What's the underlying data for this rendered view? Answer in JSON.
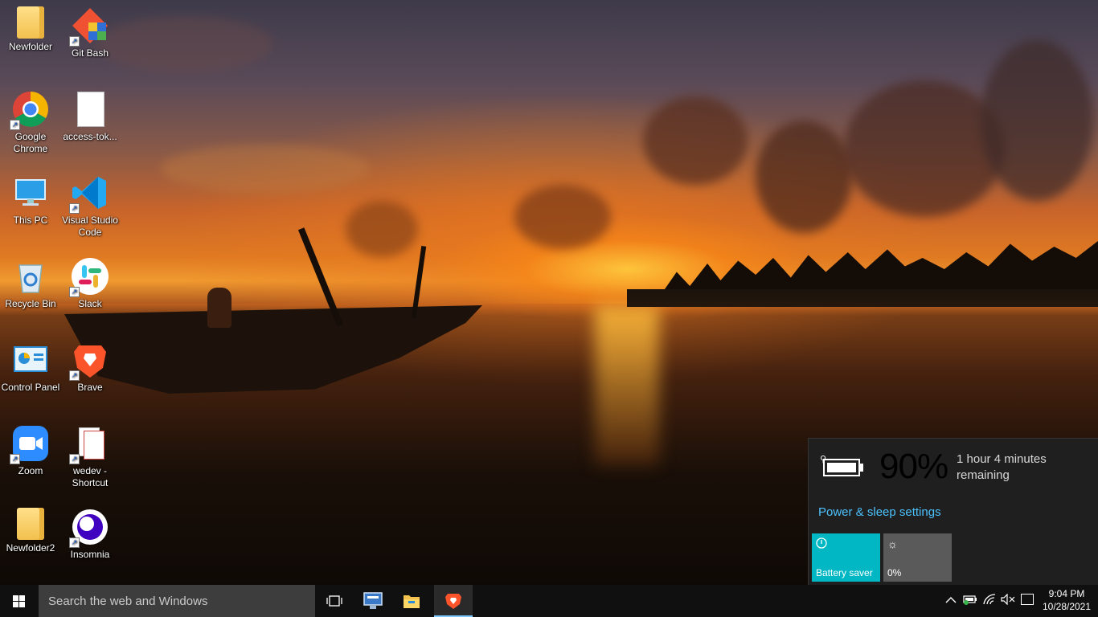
{
  "desktop": {
    "icons": [
      {
        "label": "Newfolder"
      },
      {
        "label": "Git Bash"
      },
      {
        "label": "Google Chrome"
      },
      {
        "label": "access-tok..."
      },
      {
        "label": "This PC"
      },
      {
        "label": "Visual Studio Code"
      },
      {
        "label": "Recycle Bin"
      },
      {
        "label": "Slack"
      },
      {
        "label": "Control Panel"
      },
      {
        "label": "Brave"
      },
      {
        "label": "Zoom"
      },
      {
        "label": "wedev - Shortcut"
      },
      {
        "label": "Newfolder2"
      },
      {
        "label": "Insomnia"
      }
    ]
  },
  "battery_flyout": {
    "percent_text": "90%",
    "percent_value": 90,
    "remaining_text": "1 hour 4 minutes remaining",
    "power_settings_link": "Power & sleep settings",
    "tiles": [
      {
        "label": "Battery saver",
        "color": "#00b7c3",
        "icon": "battery-saver-icon"
      },
      {
        "label": "0%",
        "color": "#5a5a5a",
        "icon": "brightness-icon"
      }
    ]
  },
  "taskbar": {
    "search_placeholder": "Search the web and Windows",
    "pinned": [
      "task-view-icon",
      "remote-desktop-icon",
      "file-explorer-icon",
      "brave-icon"
    ],
    "clock": {
      "time": "9:04 PM",
      "date": "10/28/2021"
    },
    "tray": [
      "chevron-up-icon",
      "battery-icon",
      "wifi-icon",
      "volume-muted-icon",
      "notification-icon"
    ]
  },
  "colors": {
    "taskbar_bg": "#101010",
    "search_bg": "#3d3d3d",
    "flyout_bg": "#1f1f1f",
    "accent": "#00b7c3",
    "link": "#4cc2ff"
  }
}
